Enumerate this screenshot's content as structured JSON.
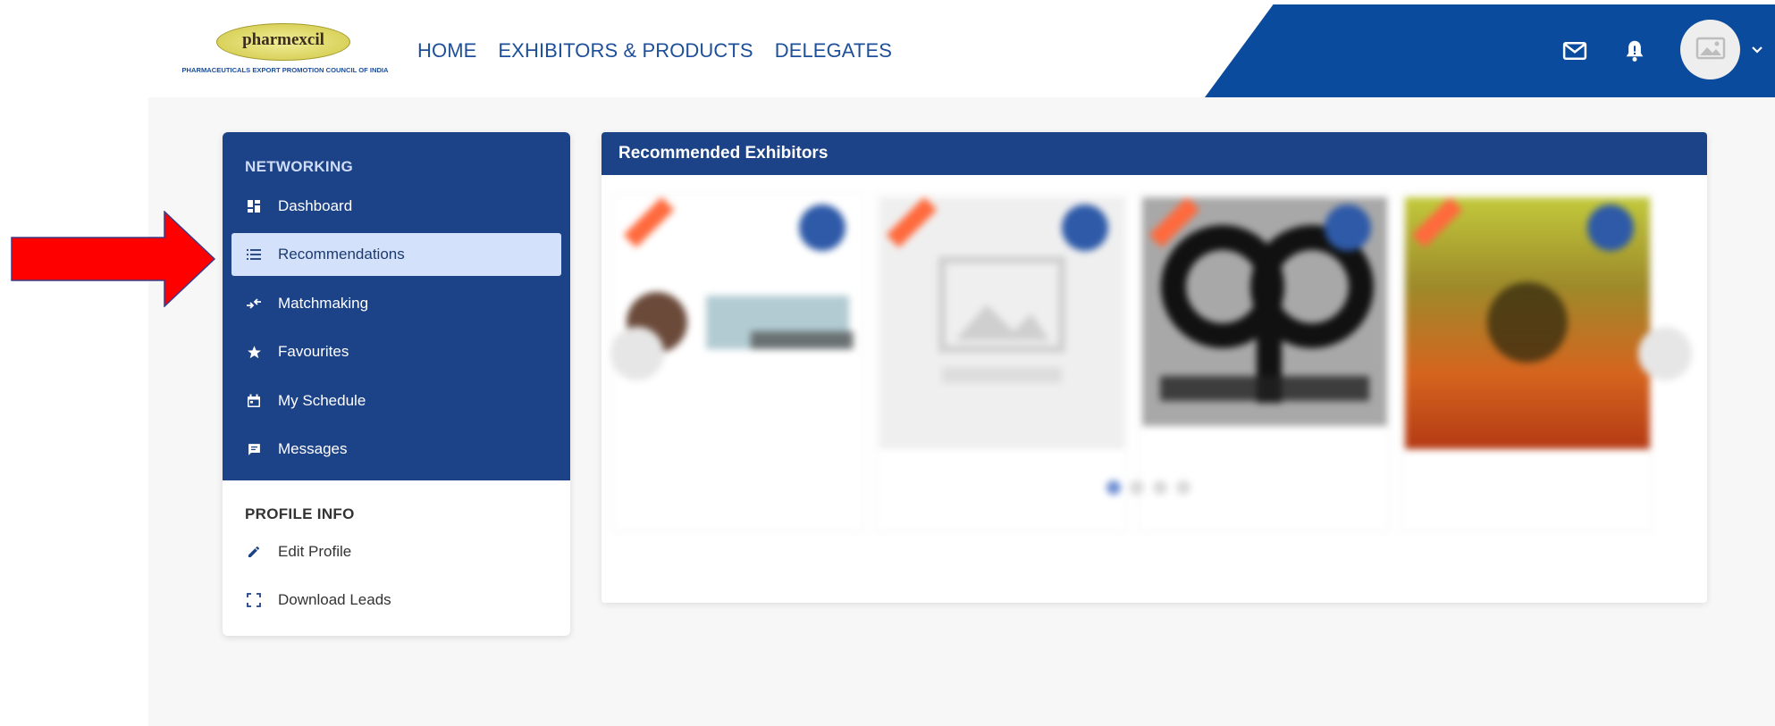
{
  "header": {
    "logo": {
      "brand": "pharmexcil",
      "tagline": "PHARMACEUTICALS EXPORT PROMOTION COUNCIL OF INDIA"
    },
    "nav": [
      {
        "label": "HOME"
      },
      {
        "label": "EXHIBITORS & PRODUCTS"
      },
      {
        "label": "DELEGATES"
      }
    ],
    "icons": {
      "mail": "mail-icon",
      "bell": "bell-icon",
      "avatar": "image-placeholder-icon",
      "chevron": "chevron-down-icon"
    },
    "colors": {
      "brand_blue": "#0a4b9d",
      "nav_text": "#1d4f9a"
    }
  },
  "sidebar": {
    "networking_heading": "NETWORKING",
    "networking_items": [
      {
        "label": "Dashboard",
        "icon": "dashboard-icon"
      },
      {
        "label": "Recommendations",
        "icon": "list-icon",
        "active": true
      },
      {
        "label": "Matchmaking",
        "icon": "compare-arrows-icon"
      },
      {
        "label": "Favourites",
        "icon": "star-icon"
      },
      {
        "label": "My Schedule",
        "icon": "calendar-icon"
      },
      {
        "label": "Messages",
        "icon": "chat-icon"
      }
    ],
    "profile_heading": "PROFILE INFO",
    "profile_items": [
      {
        "label": "Edit Profile",
        "icon": "pencil-icon"
      },
      {
        "label": "Download Leads",
        "icon": "expand-icon"
      }
    ],
    "colors": {
      "panel": "#1c4288",
      "active_bg": "#d4e1fb"
    }
  },
  "recommended": {
    "title": "Recommended Exhibitors",
    "carousel_pages": 4,
    "active_page": 1
  },
  "annotation": {
    "arrow_color": "#ff0000"
  }
}
